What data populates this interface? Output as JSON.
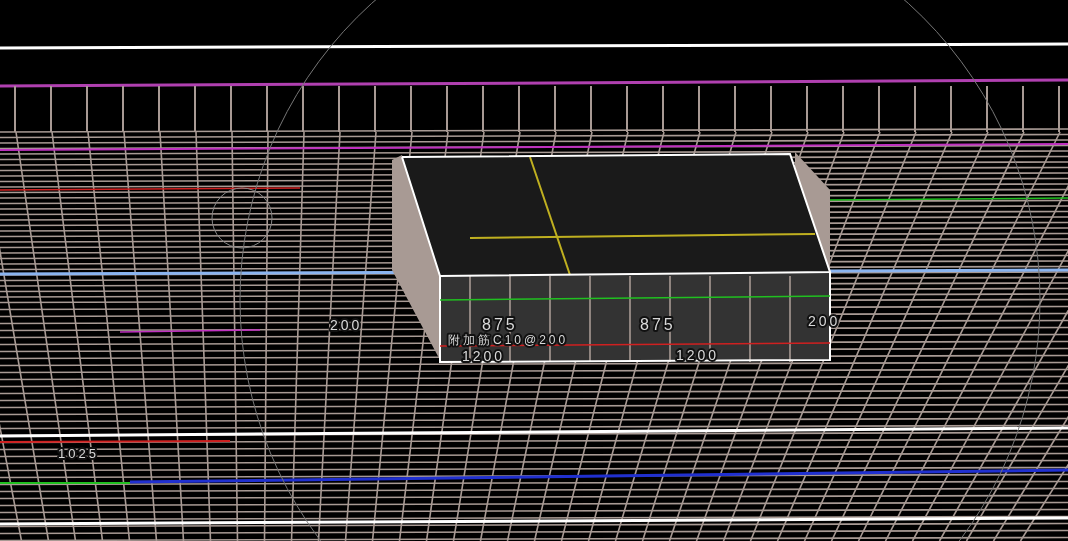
{
  "viewport": {
    "labels": [
      {
        "text": "200"
      },
      {
        "text": "875"
      },
      {
        "text": "875"
      },
      {
        "text": "200"
      },
      {
        "text": "附加筋C10@200"
      },
      {
        "text": "1200"
      },
      {
        "text": "1200"
      },
      {
        "text": "1025"
      }
    ]
  }
}
